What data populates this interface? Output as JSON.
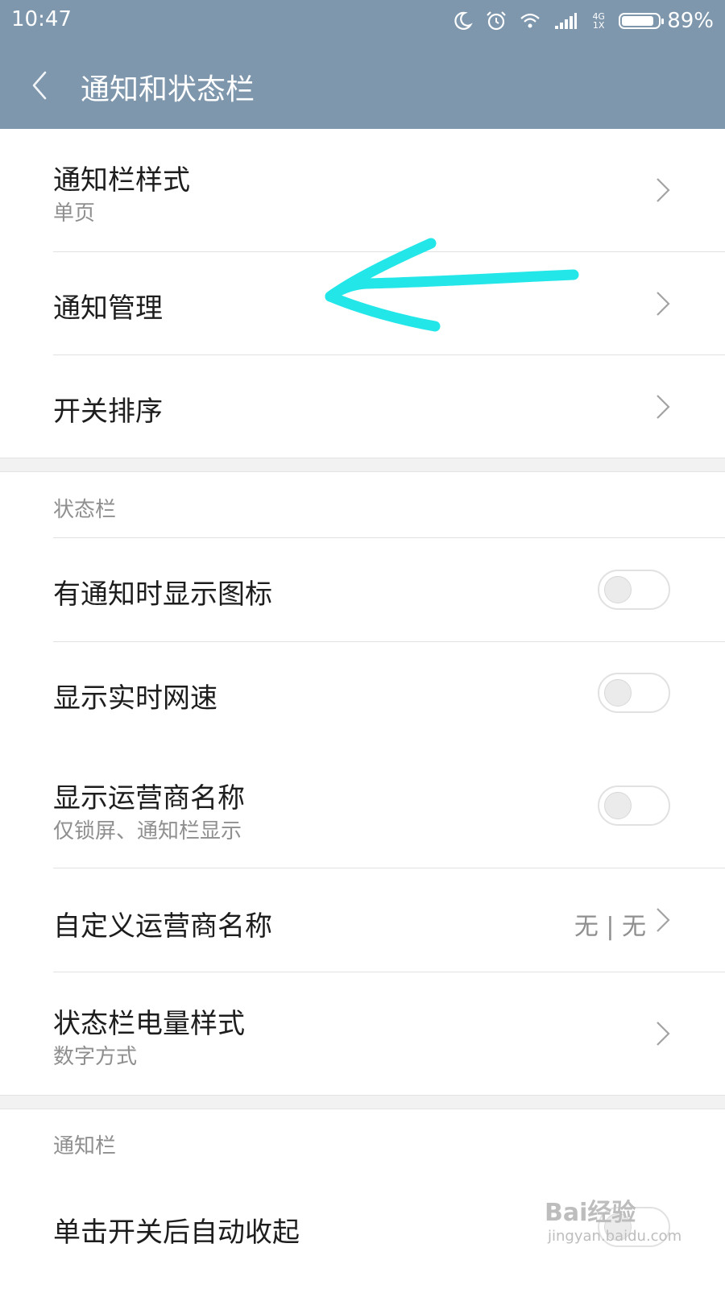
{
  "status_bar": {
    "time": "10:47",
    "network_label": "4G 1X",
    "battery": "89%",
    "battery_level": 0.89,
    "icons": [
      "moon-icon",
      "alarm-icon",
      "wifi-icon",
      "signal-icon",
      "battery-icon"
    ]
  },
  "header": {
    "title": "通知和状态栏",
    "background": "#7e97ad"
  },
  "group1": {
    "items": [
      {
        "title": "通知栏样式",
        "subtitle": "单页"
      },
      {
        "title": "通知管理"
      },
      {
        "title": "开关排序"
      }
    ]
  },
  "status_section": {
    "header": "状态栏",
    "items": [
      {
        "title": "有通知时显示图标",
        "toggle_on": false
      },
      {
        "title": "显示实时网速",
        "toggle_on": false
      },
      {
        "title": "显示运营商名称",
        "subtitle": "仅锁屏、通知栏显示",
        "toggle_on": false
      },
      {
        "title": "自定义运营商名称",
        "value": "无 | 无"
      },
      {
        "title": "状态栏电量样式",
        "subtitle": "数字方式"
      }
    ]
  },
  "notification_section": {
    "header": "通知栏",
    "items": [
      {
        "title": "单击开关后自动收起",
        "toggle_on": false
      }
    ]
  },
  "annotation": {
    "color": "#22e6e8"
  },
  "watermark": {
    "main": "Bai经验",
    "sub": "jingyan.baidu.com"
  }
}
